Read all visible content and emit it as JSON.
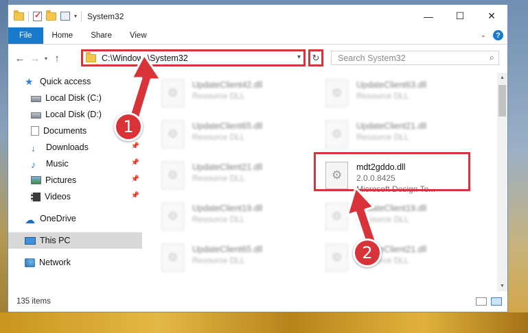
{
  "window": {
    "title": "System32"
  },
  "ribbon": {
    "tabs": [
      "File",
      "Home",
      "Share",
      "View"
    ]
  },
  "address": {
    "path": "C:\\Windows\\System32",
    "search_placeholder": "Search System32"
  },
  "nav": {
    "items": [
      {
        "label": "Quick access",
        "icon": "star-icon",
        "pinned": false
      },
      {
        "label": "Local Disk (C:)",
        "icon": "disk-icon",
        "pinned": false
      },
      {
        "label": "Local Disk (D:)",
        "icon": "disk-icon",
        "pinned": false
      },
      {
        "label": "Documents",
        "icon": "documents-icon",
        "pinned": false
      },
      {
        "label": "Downloads",
        "icon": "download-icon",
        "pinned": true
      },
      {
        "label": "Music",
        "icon": "music-icon",
        "pinned": true
      },
      {
        "label": "Pictures",
        "icon": "pictures-icon",
        "pinned": true
      },
      {
        "label": "Videos",
        "icon": "videos-icon",
        "pinned": true
      },
      {
        "label": "OneDrive",
        "icon": "cloud-icon",
        "pinned": false
      },
      {
        "label": "This PC",
        "icon": "pc-icon",
        "pinned": false,
        "selected": true
      },
      {
        "label": "Network",
        "icon": "network-icon",
        "pinned": false
      }
    ]
  },
  "files": [
    {
      "name": "UpdateClient42.dll",
      "sub": "Resource DLL",
      "blurred": true
    },
    {
      "name": "UpdateClient63.dll",
      "sub": "Resource DLL",
      "blurred": true
    },
    {
      "name": "UpdateClient65.dll",
      "sub": "Resource DLL",
      "blurred": true
    },
    {
      "name": "UpdateClient21.dll",
      "sub": "Resource DLL",
      "blurred": true
    },
    {
      "name": "UpdateClient21.dll",
      "sub": "Resource DLL",
      "blurred": true
    },
    {
      "name": "mdt2gddo.dll",
      "sub": "2.0.0.8425",
      "sub2": "Microsoft Design To...",
      "blurred": false
    },
    {
      "name": "UpdateClient19.dll",
      "sub": "Resource DLL",
      "blurred": true
    },
    {
      "name": "UpdateClient19.dll",
      "sub": "Resource DLL",
      "blurred": true
    },
    {
      "name": "UpdateClient65.dll",
      "sub": "Resource DLL",
      "blurred": true
    },
    {
      "name": "UpdateClient21.dll",
      "sub": "Resource DLL",
      "blurred": true
    }
  ],
  "status": {
    "item_count": "135 items"
  },
  "callouts": [
    "1",
    "2"
  ],
  "colors": {
    "accent": "#1979ca",
    "highlight": "#d9333a"
  }
}
